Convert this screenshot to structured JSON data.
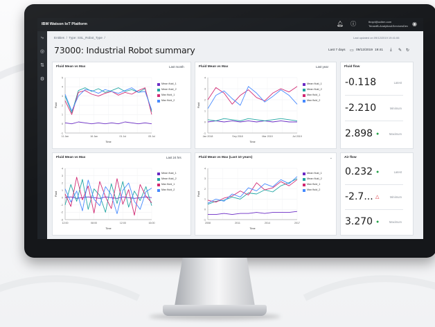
{
  "app": {
    "name": "IBM Watson IoT Platform"
  },
  "user": {
    "line1": "tboyd@ucibm.com",
    "line2": "TenantB-Analytics&ServicesDev"
  },
  "breadcrumb": {
    "items": [
      "Entities",
      "Type: SSL_Robot_Type",
      ""
    ]
  },
  "last_updated": "Last updated on 09/12/2019 19:41:06",
  "page": {
    "title": "73000: Industrial Robot summary"
  },
  "toolbar": {
    "range_preset": "Last 7 days",
    "date": "09/12/2019",
    "time": "19:41"
  },
  "colors": {
    "purple": "#6929c4",
    "teal": "#1fa5a2",
    "magenta": "#d12771",
    "blue": "#4589ff"
  },
  "cards": [
    {
      "title": "Fluid Mean vs Max",
      "range": "Last month",
      "xlabel": "Time",
      "ylabel": "Fluid",
      "legend": [
        "Mean fluid_1",
        "Mean fluid_2",
        "Max fluid_1",
        "Max fluid_2"
      ]
    },
    {
      "title": "Fluid Mean vs Max",
      "range": "Last year",
      "xlabel": "Time",
      "ylabel": "Fluid",
      "legend": [
        "Mean fluid_1",
        "Mean fluid_2",
        "Max fluid_1",
        "Max fluid_2"
      ]
    },
    {
      "title": "Fluid Mean vs Max",
      "range": "Last 24 hrs",
      "xlabel": "Time",
      "ylabel": "Fluid",
      "legend": [
        "Mean fluid_1",
        "Mean fluid_2",
        "Max fluid_1",
        "Max fluid_2"
      ]
    },
    {
      "title": "Fluid Mean vs Max (Last 10 years)",
      "range": "",
      "xlabel": "Time",
      "ylabel": "Fluid",
      "legend": [
        "Mean fluid_1",
        "Mean fluid_2",
        "Max fluid_1",
        "Max fluid_2"
      ]
    }
  ],
  "kpi_cards": [
    {
      "title": "Fluid flow",
      "values": [
        {
          "value": "-0.118",
          "label": "Latest",
          "marker": ""
        },
        {
          "value": "-2.210",
          "label": "Minimum",
          "marker": ""
        },
        {
          "value": "2.898",
          "label": "Maximum",
          "marker": "up"
        }
      ]
    },
    {
      "title": "Air flow",
      "values": [
        {
          "value": "0.232",
          "label": "Latest",
          "marker": "up"
        },
        {
          "value": "-2.7...",
          "label": "Minimum",
          "marker": "warn"
        },
        {
          "value": "3.270",
          "label": "Maximum",
          "marker": "up"
        }
      ]
    }
  ],
  "chart_data": [
    {
      "type": "line",
      "title": "Fluid Mean vs Max",
      "xlabel": "Time",
      "ylabel": "Fluid",
      "x": [
        "11 Jan",
        "",
        "16 Jan",
        "",
        "01 Jul",
        "",
        "05 Jul"
      ],
      "ylim": [
        -1,
        5
      ],
      "yticks": [
        -1,
        0,
        1,
        2,
        3,
        4,
        5
      ],
      "series": [
        {
          "name": "Mean fluid_1",
          "color": "#6929c4",
          "values": [
            0.1,
            0.0,
            0.2,
            0.1,
            0.0,
            0.1,
            0.0,
            0.1,
            0.0,
            0.2,
            0.1,
            0.0,
            0.1,
            0.0
          ]
        },
        {
          "name": "Mean fluid_2",
          "color": "#1fa5a2",
          "values": [
            3.0,
            1.2,
            3.6,
            3.9,
            3.5,
            3.8,
            3.4,
            3.6,
            3.9,
            3.5,
            3.7,
            3.4,
            3.8,
            1.3
          ]
        },
        {
          "name": "Max fluid_1",
          "color": "#d12771",
          "values": [
            2.5,
            1.0,
            3.4,
            3.6,
            3.2,
            3.0,
            3.3,
            3.5,
            3.1,
            3.4,
            3.2,
            3.6,
            3.9,
            1.0
          ]
        },
        {
          "name": "Max fluid_2",
          "color": "#4589ff",
          "values": [
            3.2,
            1.4,
            3.0,
            3.7,
            3.6,
            3.3,
            3.7,
            3.5,
            3.3,
            3.6,
            3.9,
            3.4,
            3.5,
            1.5
          ]
        }
      ]
    },
    {
      "type": "line",
      "title": "Fluid Mean vs Max",
      "xlabel": "Time",
      "ylabel": "Fluid",
      "x": [
        "Jan 2018",
        "",
        "Sep 2018",
        "",
        "Mar 2019",
        "",
        "Jul 2019"
      ],
      "ylim": [
        -1,
        4
      ],
      "yticks": [
        -1,
        0,
        1,
        2,
        3,
        4
      ],
      "series": [
        {
          "name": "Mean fluid_1",
          "color": "#6929c4",
          "values": [
            0.0,
            0.1,
            0.0,
            0.1,
            0.0,
            0.1,
            0.0,
            0.1,
            0.0,
            0.1,
            0.0,
            0.0
          ]
        },
        {
          "name": "Mean fluid_2",
          "color": "#1fa5a2",
          "values": [
            0.2,
            0.1,
            0.3,
            0.2,
            0.1,
            0.3,
            0.2,
            0.1,
            0.2,
            0.3,
            0.2,
            0.1
          ]
        },
        {
          "name": "Max fluid_1",
          "color": "#d12771",
          "values": [
            2.0,
            3.1,
            2.6,
            1.6,
            2.4,
            2.9,
            2.2,
            1.9,
            2.6,
            3.0,
            2.7,
            3.2
          ]
        },
        {
          "name": "Max fluid_2",
          "color": "#4589ff",
          "values": [
            1.2,
            2.4,
            2.8,
            2.1,
            1.5,
            3.2,
            2.6,
            1.8,
            2.3,
            2.9,
            2.4,
            1.6
          ]
        }
      ]
    },
    {
      "type": "line",
      "title": "Fluid Mean vs Max",
      "xlabel": "Time",
      "ylabel": "Fluid",
      "x": [
        "12:00",
        "",
        "08:00",
        "",
        "12:00",
        "",
        "16:00"
      ],
      "ylim": [
        -3,
        4
      ],
      "yticks": [
        -3,
        -2,
        -1,
        0,
        1,
        2,
        3,
        4
      ],
      "series": [
        {
          "name": "Mean fluid_1",
          "color": "#6929c4",
          "values": [
            0.0,
            0.1,
            -0.1,
            0.0,
            0.1,
            0.0,
            -0.1,
            0.1,
            0.0,
            -0.1,
            0.1,
            0.0,
            -0.1,
            0.0,
            0.1,
            0.0
          ]
        },
        {
          "name": "Mean fluid_2",
          "color": "#1fa5a2",
          "values": [
            -1.0,
            1.8,
            -0.5,
            2.5,
            -1.6,
            1.2,
            0.3,
            -2.0,
            1.9,
            -0.8,
            2.2,
            -1.3,
            0.9,
            -0.4,
            1.5,
            -1.1
          ]
        },
        {
          "name": "Max fluid_1",
          "color": "#d12771",
          "values": [
            0.5,
            -1.2,
            2.8,
            -0.3,
            1.6,
            -2.1,
            2.2,
            0.1,
            -1.5,
            2.6,
            -0.9,
            1.1,
            -2.4,
            1.8,
            0.2,
            -0.7
          ]
        },
        {
          "name": "Max fluid_2",
          "color": "#4589ff",
          "values": [
            1.2,
            -0.6,
            0.9,
            -1.8,
            2.4,
            -0.2,
            -1.1,
            1.5,
            0.4,
            -2.2,
            1.0,
            2.0,
            -0.5,
            -1.6,
            0.8,
            1.3
          ]
        }
      ]
    },
    {
      "type": "line",
      "title": "Fluid Mean vs Max (Last 10 years)",
      "xlabel": "Time",
      "ylabel": "Fluid",
      "x": [
        "2008",
        "",
        "2011",
        "",
        "2014",
        "",
        "2017"
      ],
      "ylim": [
        -1,
        4
      ],
      "yticks": [
        -1,
        0,
        1,
        2,
        3,
        4
      ],
      "series": [
        {
          "name": "Mean fluid_1",
          "color": "#6929c4",
          "values": [
            -0.5,
            -0.5,
            -0.4,
            -0.5,
            -0.4,
            -0.4,
            -0.3,
            -0.4,
            -0.3,
            -0.3,
            -0.3,
            -0.2
          ]
        },
        {
          "name": "Mean fluid_2",
          "color": "#1fa5a2",
          "values": [
            0.5,
            0.8,
            0.9,
            1.2,
            1.0,
            1.6,
            1.5,
            1.9,
            1.7,
            2.3,
            2.6,
            3.0
          ]
        },
        {
          "name": "Max fluid_1",
          "color": "#d12771",
          "values": [
            0.9,
            0.7,
            1.1,
            1.3,
            1.8,
            1.4,
            2.6,
            1.9,
            2.1,
            2.7,
            2.3,
            2.9
          ]
        },
        {
          "name": "Max fluid_2",
          "color": "#4589ff",
          "values": [
            0.6,
            1.0,
            0.8,
            1.5,
            1.2,
            2.1,
            1.8,
            2.5,
            2.2,
            2.9,
            2.5,
            3.2
          ]
        }
      ]
    }
  ]
}
